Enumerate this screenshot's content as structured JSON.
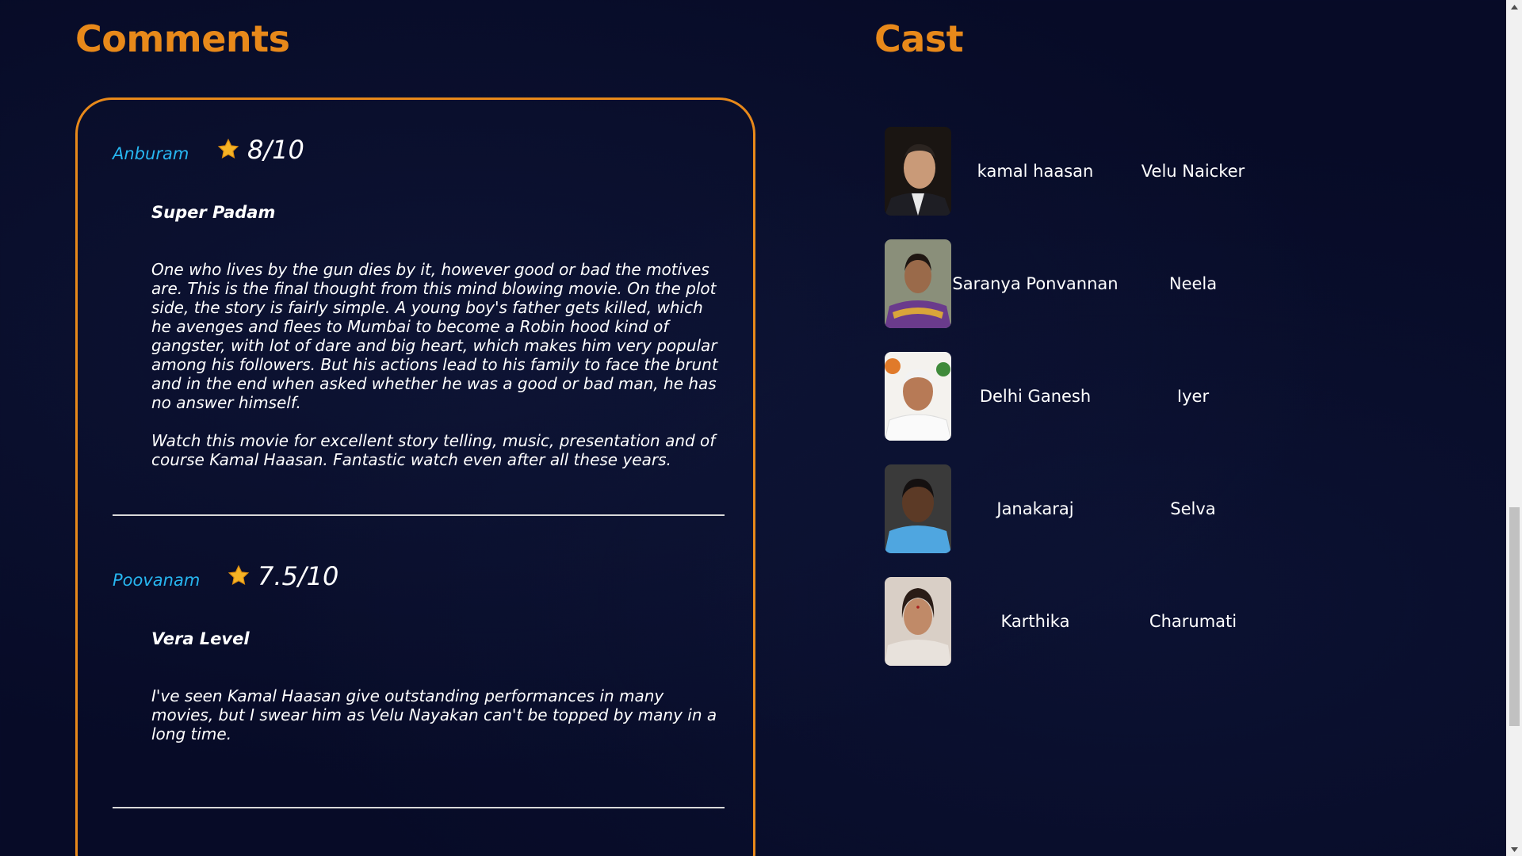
{
  "comments": {
    "title": "Comments",
    "items": [
      {
        "user": "Anburam",
        "rating": "8/10",
        "headline": "Super Padam",
        "paragraphs": [
          "One who lives by the gun dies by it, however good or bad the motives are. This is the final thought from this mind blowing movie. On the plot side, the story is fairly simple. A young boy's father gets killed, which he avenges and flees to Mumbai to become a Robin hood kind of gangster, with lot of dare and big heart, which makes him very popular among his followers. But his actions lead to his family to face the brunt and in the end when asked whether he was a good or bad man, he has no answer himself.",
          "Watch this movie for excellent story telling, music, presentation and of course Kamal Haasan. Fantastic watch even after all these years."
        ]
      },
      {
        "user": "Poovanam",
        "rating": "7.5/10",
        "headline": "Vera Level",
        "paragraphs": [
          "I've seen Kamal Haasan give outstanding performances in many movies, but I swear him as Velu Nayakan can't be topped by many in a long time."
        ]
      }
    ]
  },
  "cast": {
    "title": "Cast",
    "members": [
      {
        "actor": "kamal haasan",
        "role": "Velu Naicker"
      },
      {
        "actor": "Saranya Ponvannan",
        "role": "Neela"
      },
      {
        "actor": "Delhi Ganesh",
        "role": "Iyer"
      },
      {
        "actor": "Janakaraj",
        "role": "Selva"
      },
      {
        "actor": "Karthika",
        "role": "Charumati"
      }
    ]
  },
  "colors": {
    "background": "#070b27",
    "accent": "#e8891a",
    "username": "#27b6f0",
    "star": "#f5b325"
  },
  "icons": {
    "rating": "star-icon",
    "scroll_up": "arrow-up-icon",
    "scroll_down": "arrow-down-icon"
  }
}
